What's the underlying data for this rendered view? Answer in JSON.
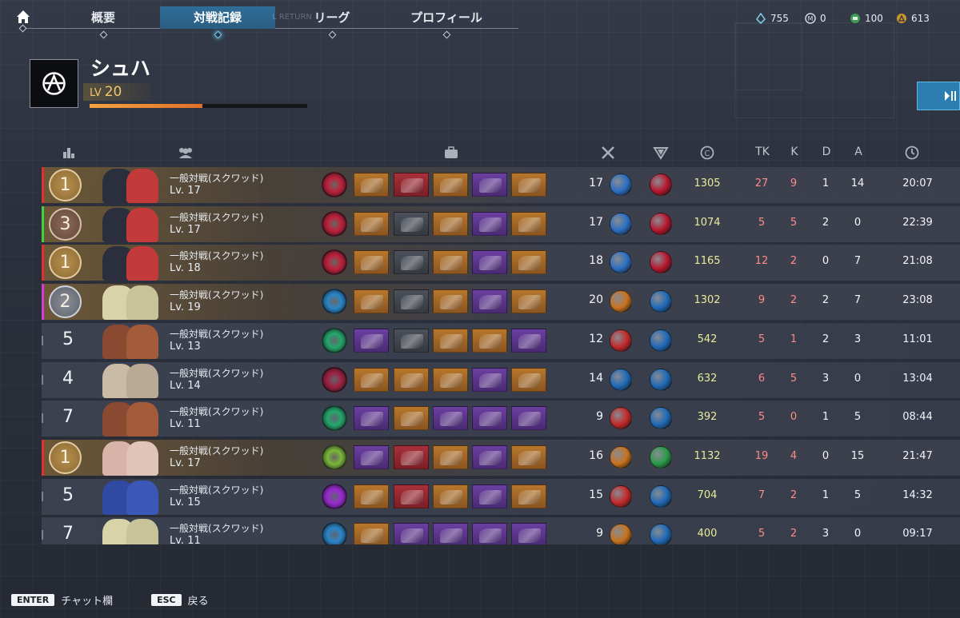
{
  "nav": {
    "tabs": [
      {
        "label": "概要"
      },
      {
        "label": "対戦記録"
      },
      {
        "label": "リーグ"
      },
      {
        "label": "プロフィール"
      }
    ],
    "ghost_text": "L RETURN"
  },
  "currencies": [
    {
      "icon": "crystal-icon",
      "value": "755"
    },
    {
      "icon": "m-coin-icon",
      "value": "0"
    },
    {
      "icon": "ticket-icon",
      "value": "100"
    },
    {
      "icon": "gold-coin-icon",
      "value": "613"
    }
  ],
  "profile": {
    "name": "シュハ",
    "level_label": "LV",
    "level": "20",
    "xp_fraction": 0.52
  },
  "columns": {
    "tk": "TK",
    "k": "K",
    "d": "D",
    "a": "A"
  },
  "matches": [
    {
      "rank": "1",
      "result": "win",
      "accent": "#e03030",
      "mode": "一般対戦(スクワッド)",
      "lv": "Lv. 17",
      "kills": "17",
      "score": "1305",
      "tk": "27",
      "k": "9",
      "d": "1",
      "a": "14",
      "time": "20:07",
      "ability": "#c0203a",
      "items": [
        "orange",
        "red",
        "orange",
        "purple",
        "orange"
      ],
      "orb1": "#2c6fc2",
      "orb2": "#b8182e",
      "p1": "#2b2f3d",
      "p2": "#c23a3a"
    },
    {
      "rank": "3",
      "result": "win",
      "accent": "#3ed23e",
      "mode": "一般対戦(スクワッド)",
      "lv": "Lv. 17",
      "kills": "17",
      "score": "1074",
      "tk": "5",
      "k": "5",
      "d": "2",
      "a": "0",
      "time": "22:39",
      "ability": "#c0203a",
      "items": [
        "orange",
        "gray",
        "orange",
        "purple",
        "orange"
      ],
      "orb1": "#2c6fc2",
      "orb2": "#b8182e",
      "p1": "#2b2f3d",
      "p2": "#c23a3a"
    },
    {
      "rank": "1",
      "result": "win",
      "accent": "#e03030",
      "mode": "一般対戦(スクワッド)",
      "lv": "Lv. 18",
      "kills": "18",
      "score": "1165",
      "tk": "12",
      "k": "2",
      "d": "0",
      "a": "7",
      "time": "21:08",
      "ability": "#c0203a",
      "items": [
        "orange",
        "gray",
        "orange",
        "purple",
        "orange"
      ],
      "orb1": "#2c6fc2",
      "orb2": "#b8182e",
      "p1": "#2b2f3d",
      "p2": "#c23a3a"
    },
    {
      "rank": "2",
      "result": "win",
      "accent": "#d43ad4",
      "mode": "一般対戦(スクワッド)",
      "lv": "Lv. 19",
      "kills": "20",
      "score": "1302",
      "tk": "9",
      "k": "2",
      "d": "2",
      "a": "7",
      "time": "23:08",
      "ability": "#2a86c8",
      "items": [
        "orange",
        "gray",
        "orange",
        "purple",
        "orange"
      ],
      "orb1": "#c8731e",
      "orb2": "#1f6ab8",
      "p1": "#d9d3a8",
      "p2": "#c9c39a"
    },
    {
      "rank": "5",
      "result": "none",
      "accent": "",
      "mode": "一般対戦(スクワッド)",
      "lv": "Lv. 13",
      "kills": "12",
      "score": "542",
      "tk": "5",
      "k": "1",
      "d": "2",
      "a": "3",
      "time": "11:01",
      "ability": "#23a86a",
      "items": [
        "purple",
        "gray",
        "orange",
        "orange",
        "purple"
      ],
      "orb1": "#c42a2a",
      "orb2": "#1f6ab8",
      "p1": "#8a4a32",
      "p2": "#a35b3a"
    },
    {
      "rank": "4",
      "result": "none",
      "accent": "",
      "mode": "一般対戦(スクワッド)",
      "lv": "Lv. 14",
      "kills": "14",
      "score": "632",
      "tk": "6",
      "k": "5",
      "d": "3",
      "a": "0",
      "time": "13:04",
      "ability": "#a02040",
      "items": [
        "orange",
        "orange",
        "orange",
        "purple",
        "orange"
      ],
      "orb1": "#1f6ab8",
      "orb2": "#1f6ab8",
      "p1": "#c9bba5",
      "p2": "#b8aa94"
    },
    {
      "rank": "7",
      "result": "none",
      "accent": "",
      "mode": "一般対戦(スクワッド)",
      "lv": "Lv. 11",
      "kills": "9",
      "score": "392",
      "tk": "5",
      "k": "0",
      "d": "1",
      "a": "5",
      "time": "08:44",
      "ability": "#23a86a",
      "items": [
        "purple",
        "orange",
        "purple",
        "purple",
        "purple"
      ],
      "orb1": "#c42a2a",
      "orb2": "#1f6ab8",
      "p1": "#8a4a32",
      "p2": "#a35b3a"
    },
    {
      "rank": "1",
      "result": "win",
      "accent": "#e03030",
      "mode": "一般対戦(スクワッド)",
      "lv": "Lv. 17",
      "kills": "16",
      "score": "1132",
      "tk": "19",
      "k": "4",
      "d": "0",
      "a": "15",
      "time": "21:47",
      "ability": "#7ab83a",
      "items": [
        "purple",
        "red",
        "orange",
        "purple",
        "orange"
      ],
      "orb1": "#c8731e",
      "orb2": "#2a9a4a",
      "p1": "#d8b4a8",
      "p2": "#e0c4b8"
    },
    {
      "rank": "5",
      "result": "none",
      "accent": "",
      "mode": "一般対戦(スクワッド)",
      "lv": "Lv. 15",
      "kills": "15",
      "score": "704",
      "tk": "7",
      "k": "2",
      "d": "1",
      "a": "5",
      "time": "14:32",
      "ability": "#9a2ad0",
      "items": [
        "orange",
        "red",
        "orange",
        "purple",
        "orange"
      ],
      "orb1": "#c42a2a",
      "orb2": "#1f6ab8",
      "p1": "#2f4aa0",
      "p2": "#3b58b8"
    },
    {
      "rank": "7",
      "result": "none",
      "accent": "",
      "mode": "一般対戦(スクワッド)",
      "lv": "Lv. 11",
      "kills": "9",
      "score": "400",
      "tk": "5",
      "k": "2",
      "d": "3",
      "a": "0",
      "time": "09:17",
      "ability": "#2a86c8",
      "items": [
        "orange",
        "purple",
        "purple",
        "purple",
        "purple"
      ],
      "orb1": "#c8731e",
      "orb2": "#1f6ab8",
      "p1": "#d9d3a8",
      "p2": "#c9c39a"
    }
  ],
  "footer": {
    "enter_key": "ENTER",
    "enter_label": "チャット欄",
    "esc_key": "ESC",
    "esc_label": "戻る"
  }
}
